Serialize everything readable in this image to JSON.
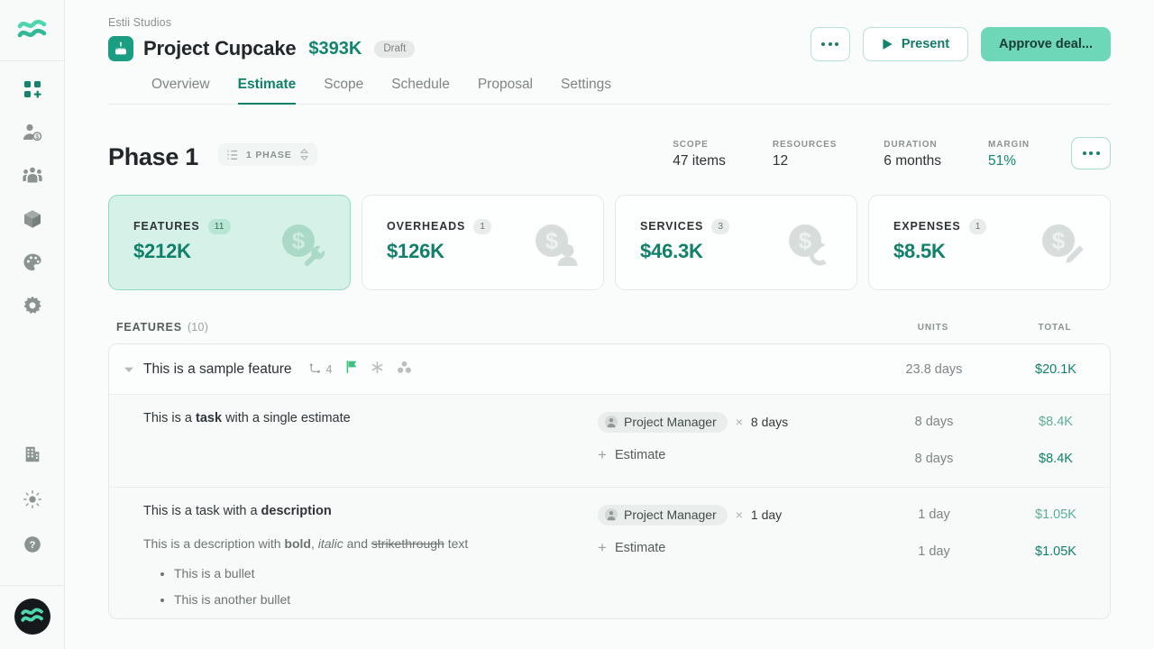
{
  "sidebar": {
    "logo_icon": "estii-wave-logo",
    "items": [
      {
        "icon": "dashboard-grid-plus-icon",
        "name": "dashboard",
        "active": true
      },
      {
        "icon": "person-dollar-icon",
        "name": "deals",
        "active": false
      },
      {
        "icon": "people-team-icon",
        "name": "resources",
        "active": false
      },
      {
        "icon": "package-box-icon",
        "name": "products",
        "active": false
      },
      {
        "icon": "palette-icon",
        "name": "branding",
        "active": false
      },
      {
        "icon": "gear-icon",
        "name": "settings",
        "active": false
      }
    ],
    "bottom_items": [
      {
        "icon": "building-icon",
        "name": "company"
      },
      {
        "icon": "sun-icon",
        "name": "theme-toggle"
      },
      {
        "icon": "help-circle-icon",
        "name": "help"
      }
    ],
    "avatar_icon": "estii-wave-logo"
  },
  "header": {
    "breadcrumb": "Estii Studios",
    "project_icon": "cupcake-icon",
    "title": "Project Cupcake",
    "value": "$393K",
    "status": "Draft",
    "more_icon": "ellipsis-icon",
    "present_label": "Present",
    "present_icon": "play-icon",
    "approve_label": "Approve deal...",
    "accent": "#11806a",
    "approve_bg": "#6ed7b7"
  },
  "tabs": [
    {
      "label": "Overview",
      "active": false
    },
    {
      "label": "Estimate",
      "active": true
    },
    {
      "label": "Scope",
      "active": false
    },
    {
      "label": "Schedule",
      "active": false
    },
    {
      "label": "Proposal",
      "active": false
    },
    {
      "label": "Settings",
      "active": false
    }
  ],
  "phase": {
    "title": "Phase 1",
    "selector_label": "1 PHASE",
    "selector_icon": "list-ordered-icon",
    "selector_chevrons_icon": "chevron-up-down-icon",
    "more_icon": "ellipsis-icon",
    "stats": [
      {
        "label": "SCOPE",
        "value": "47 items",
        "teal": false
      },
      {
        "label": "RESOURCES",
        "value": "12",
        "teal": false
      },
      {
        "label": "DURATION",
        "value": "6 months",
        "teal": false
      },
      {
        "label": "MARGIN",
        "value": "51%",
        "teal": true
      }
    ]
  },
  "cards": [
    {
      "label": "FEATURES",
      "badge": "11",
      "value": "$212K",
      "icon": "dollar-wrench-icon",
      "selected": true
    },
    {
      "label": "OVERHEADS",
      "badge": "1",
      "value": "$126K",
      "icon": "dollar-person-icon",
      "selected": false
    },
    {
      "label": "SERVICES",
      "badge": "3",
      "value": "$46.3K",
      "icon": "dollar-refresh-icon",
      "selected": false
    },
    {
      "label": "EXPENSES",
      "badge": "1",
      "value": "$8.5K",
      "icon": "dollar-pencil-icon",
      "selected": false
    }
  ],
  "table": {
    "section_label": "FEATURES",
    "section_count": "(10)",
    "col_units": "UNITS",
    "col_total": "TOTAL",
    "feature": {
      "caret_icon": "caret-down-icon",
      "title": "This is a sample feature",
      "subtask_icon": "subtask-count-icon",
      "subtask_count": "4",
      "flag_icon": "flag-icon",
      "star_icon": "asterisk-icon",
      "group_icon": "people-dots-icon",
      "units": "23.8 days",
      "total": "$20.1K"
    },
    "tasks": [
      {
        "title_pre": "This is a ",
        "title_bold": "task",
        "title_post": " with a single estimate",
        "resource": "Project Manager",
        "resource_icon": "person-avatar-icon",
        "times": "×",
        "estimate": "8 days",
        "add_label": "Estimate",
        "add_icon": "plus-icon",
        "units_1": "8 days",
        "total_1": "$8.4K",
        "units_2": "8 days",
        "total_2": "$8.4K",
        "description": null,
        "bullets": []
      },
      {
        "title_pre": "This is a task with a ",
        "title_bold": "description",
        "title_post": "",
        "resource": "Project Manager",
        "resource_icon": "person-avatar-icon",
        "times": "×",
        "estimate": "1 day",
        "add_label": "Estimate",
        "add_icon": "plus-icon",
        "units_1": "1 day",
        "total_1": "$1.05K",
        "units_2": "1 day",
        "total_2": "$1.05K",
        "desc_pre": "This is a description with ",
        "desc_bold": "bold",
        "desc_mid": ", ",
        "desc_italic": "italic",
        "desc_mid2": " and ",
        "desc_strike": "strikethrough",
        "desc_post": " text",
        "bullets": [
          "This is a bullet",
          "This is another bullet"
        ]
      }
    ]
  }
}
